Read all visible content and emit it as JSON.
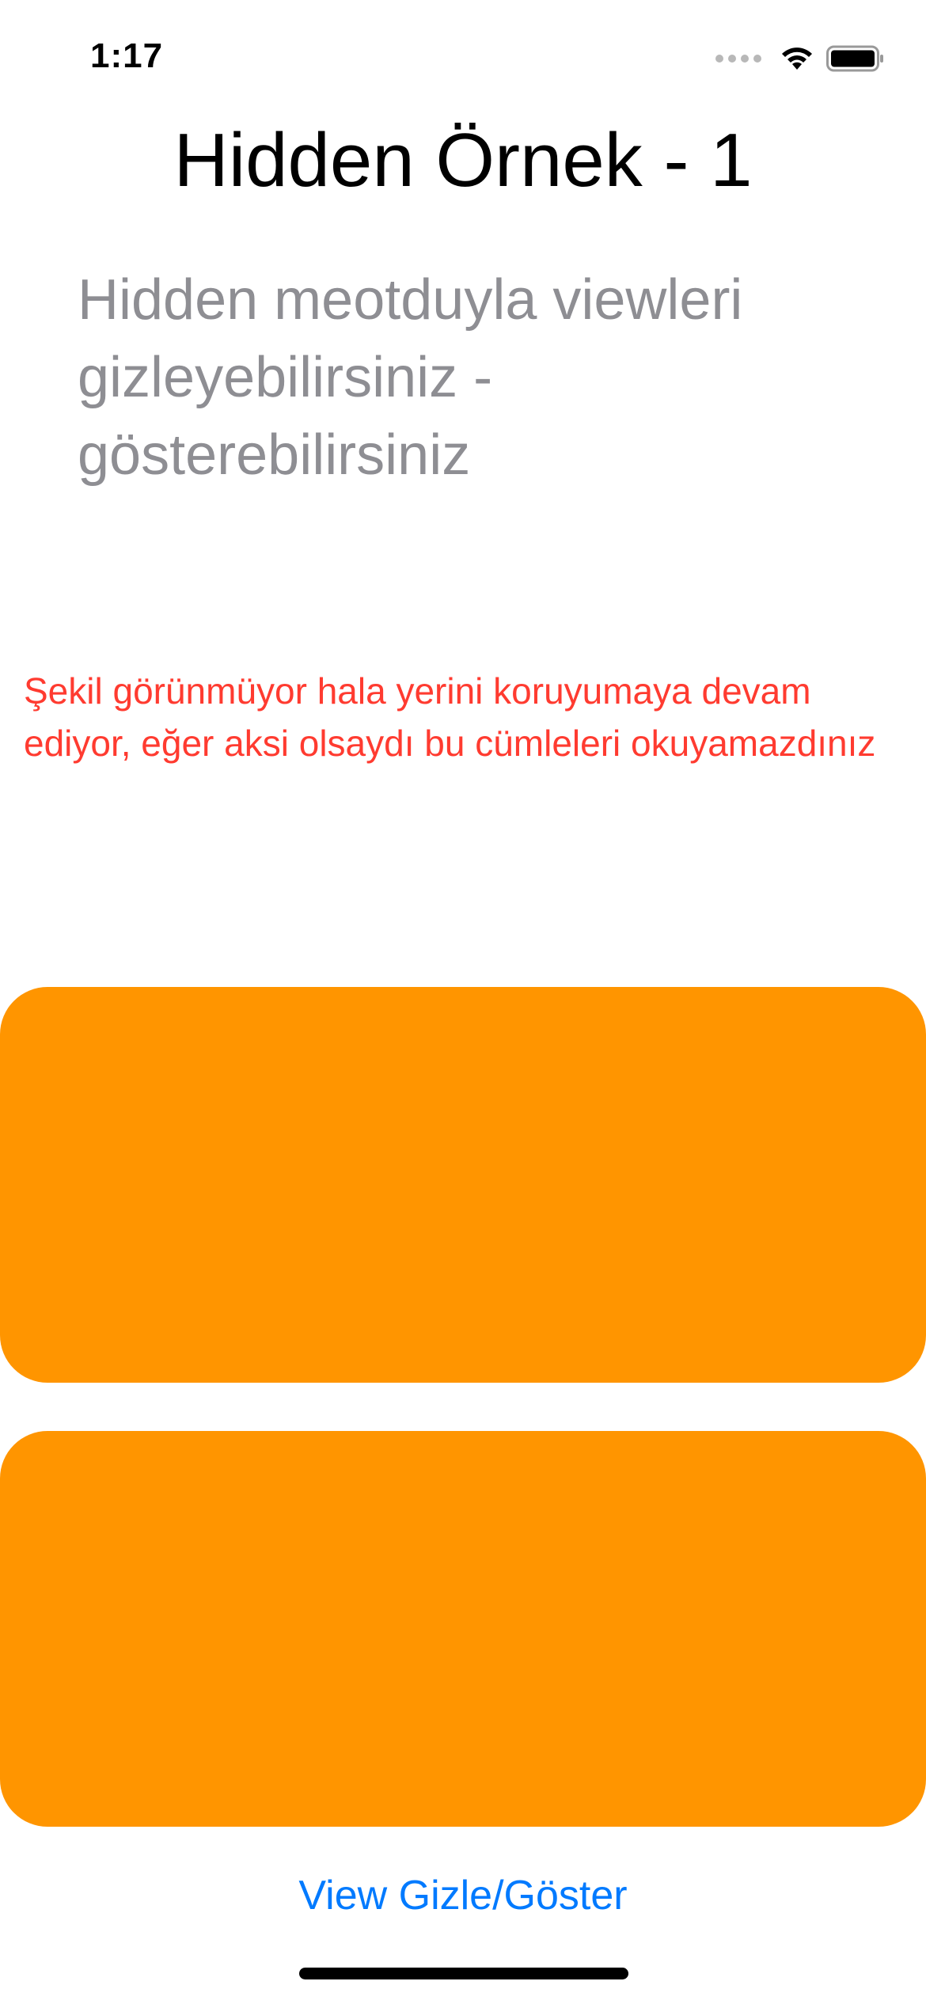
{
  "status_bar": {
    "time": "1:17",
    "icons": [
      "signal-icon",
      "wifi-icon",
      "battery-icon"
    ]
  },
  "main": {
    "title": "Hidden Örnek - 1",
    "subtitle": "Hidden meotduyla viewleri gizleyebilirsiniz - gösterebilirsiniz",
    "note": "Şekil görünmüyor hala yerini koruyumaya devam ediyor, eğer aksi olsaydı bu cümleleri okuyamazdınız",
    "toggle_label": "View Gizle/Göster"
  },
  "colors": {
    "box": "#ff9500",
    "note_text": "#ff3b30",
    "subtitle_text": "#8e8e93",
    "button_text": "#007aff"
  }
}
